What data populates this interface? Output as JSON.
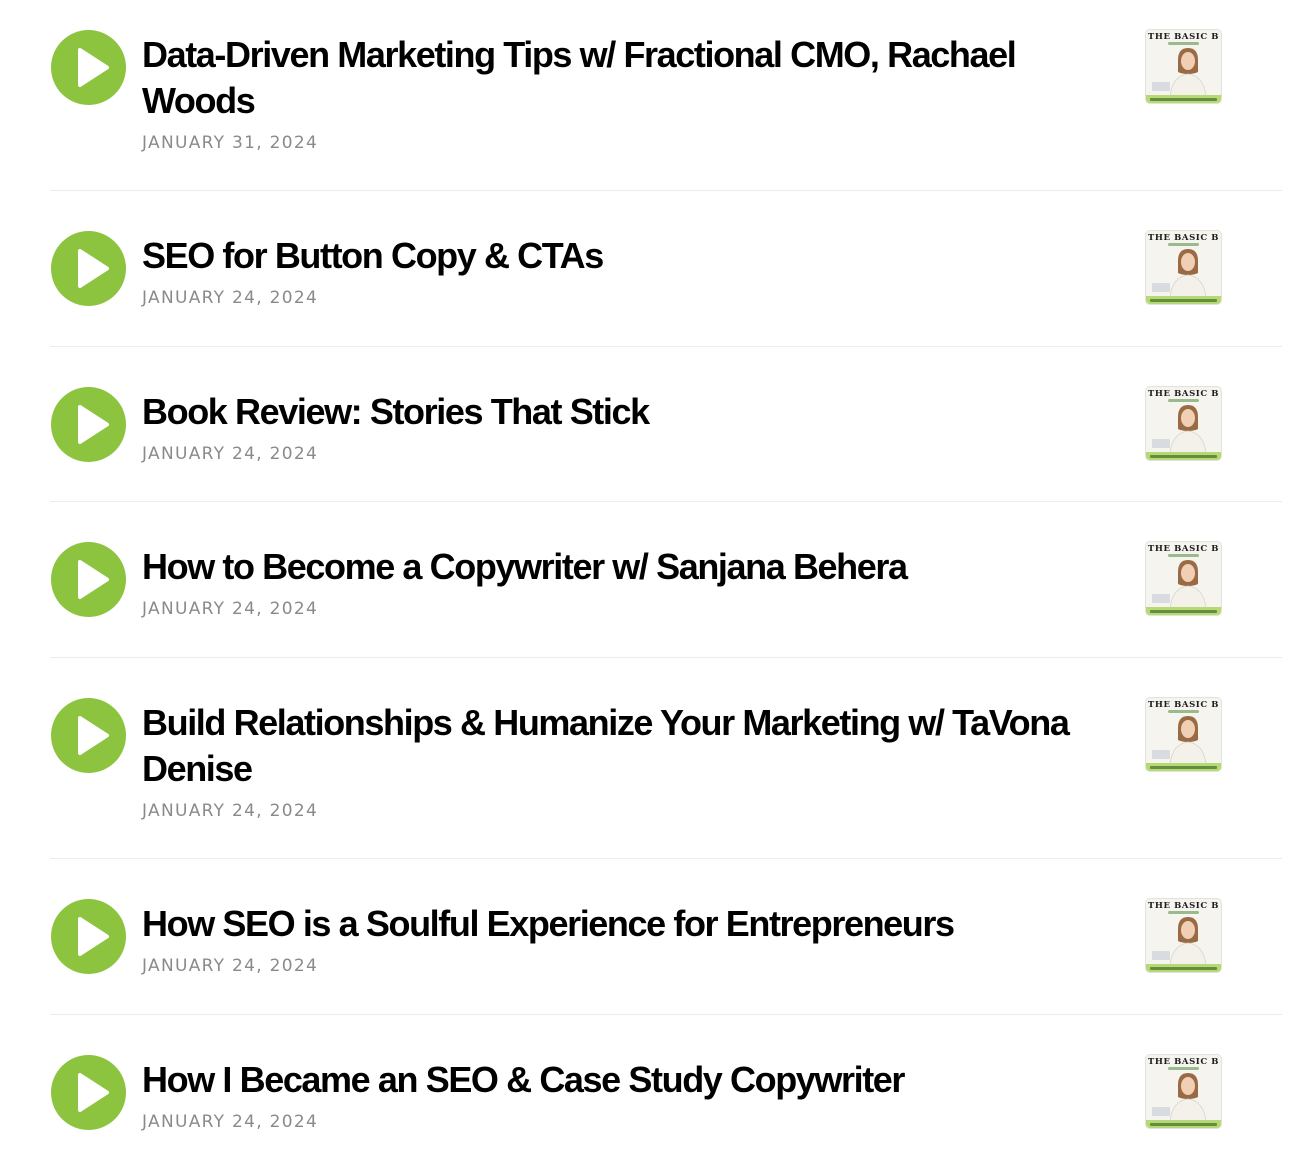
{
  "episodes": [
    {
      "title": "Data-Driven Marketing Tips w/ Fractional CMO, Rachael Woods",
      "date": "JANUARY 31, 2024"
    },
    {
      "title": "SEO for Button Copy & CTAs",
      "date": "JANUARY 24, 2024"
    },
    {
      "title": "Book Review: Stories That Stick",
      "date": "JANUARY 24, 2024"
    },
    {
      "title": "How to Become a Copywriter w/ Sanjana Behera",
      "date": "JANUARY 24, 2024"
    },
    {
      "title": "Build Relationships & Humanize Your Marketing w/ TaVona Denise",
      "date": "JANUARY 24, 2024"
    },
    {
      "title": "How SEO is a Soulful Experience for Entrepreneurs",
      "date": "JANUARY 24, 2024"
    },
    {
      "title": "How I Became an SEO & Case Study Copywriter",
      "date": "JANUARY 24, 2024"
    }
  ],
  "thumbnail": {
    "title": "THE BASIC B"
  },
  "colors": {
    "play": "#8cc43f",
    "date": "#8a8a8a",
    "divider": "#ececec"
  },
  "icons": {
    "play": "play-icon",
    "cover": "podcast-cover-thumbnail"
  }
}
